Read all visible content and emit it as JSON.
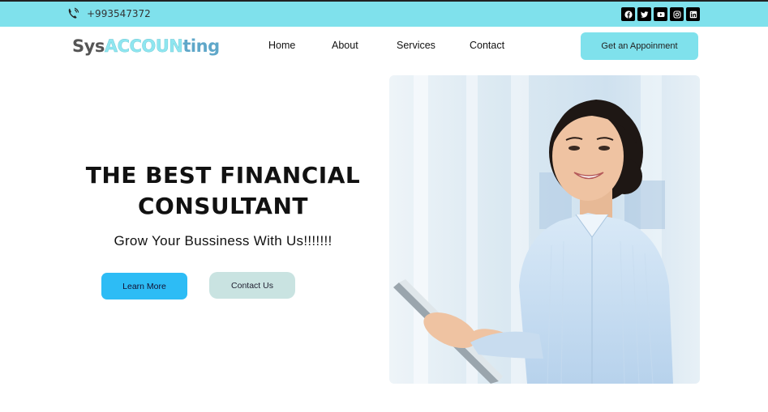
{
  "topbar": {
    "phone": "+993547372",
    "socials": [
      "facebook-icon",
      "twitter-icon",
      "youtube-icon",
      "instagram-icon",
      "linkedin-icon"
    ]
  },
  "logo": {
    "part1": "Sys",
    "part2": "ACCOUN",
    "part3": "ting"
  },
  "nav": {
    "items": [
      {
        "label": "Home"
      },
      {
        "label": "About"
      },
      {
        "label": "Services"
      },
      {
        "label": "Contact"
      }
    ],
    "cta": "Get an Appoinment"
  },
  "hero": {
    "title_line1": "THE BEST FINANCIAL",
    "title_line2": "CONSULTANT",
    "subtitle": "Grow Your Bussiness With Us!!!!!!!",
    "learn_more": "Learn More",
    "contact_us": "Contact Us"
  },
  "colors": {
    "accent": "#7fe1ec",
    "primary_button": "#2dbcf5",
    "secondary_button": "#c9e3e1"
  }
}
